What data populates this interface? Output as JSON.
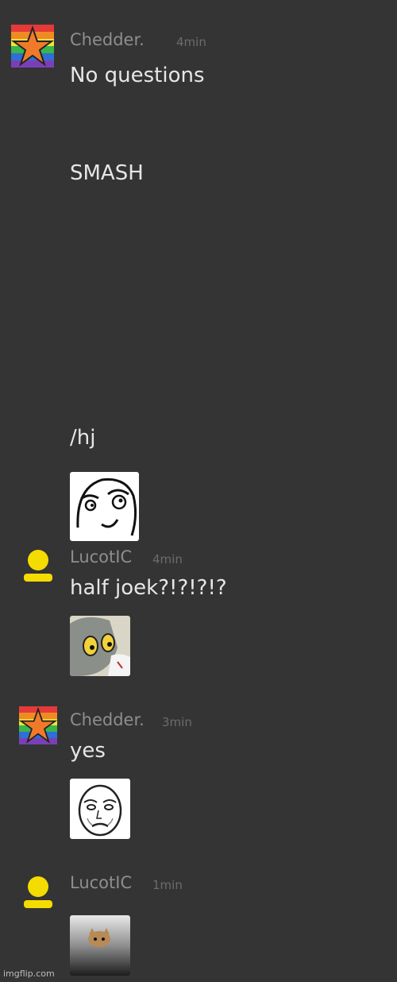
{
  "messages": [
    {
      "username": "Chedder.",
      "time": "4min",
      "avatar": "rainbow-star-icon",
      "lines": [
        "No questions",
        "SMASH",
        "/hj"
      ],
      "sticker": "smirk-rage-face"
    },
    {
      "username": "LucotIC",
      "time": "4min",
      "avatar": "yellow-person-icon",
      "lines": [
        "half joek?!?!?!?"
      ],
      "sticker": "unsettled-tom-cat"
    },
    {
      "username": "Chedder.",
      "time": "3min",
      "avatar": "rainbow-star-icon",
      "lines": [
        "yes"
      ],
      "sticker": "okay-guy-face"
    },
    {
      "username": "LucotIC",
      "time": "1min",
      "avatar": "yellow-person-icon",
      "lines": [],
      "sticker": "ceiling-cat"
    }
  ],
  "watermark": "imgflip.com"
}
